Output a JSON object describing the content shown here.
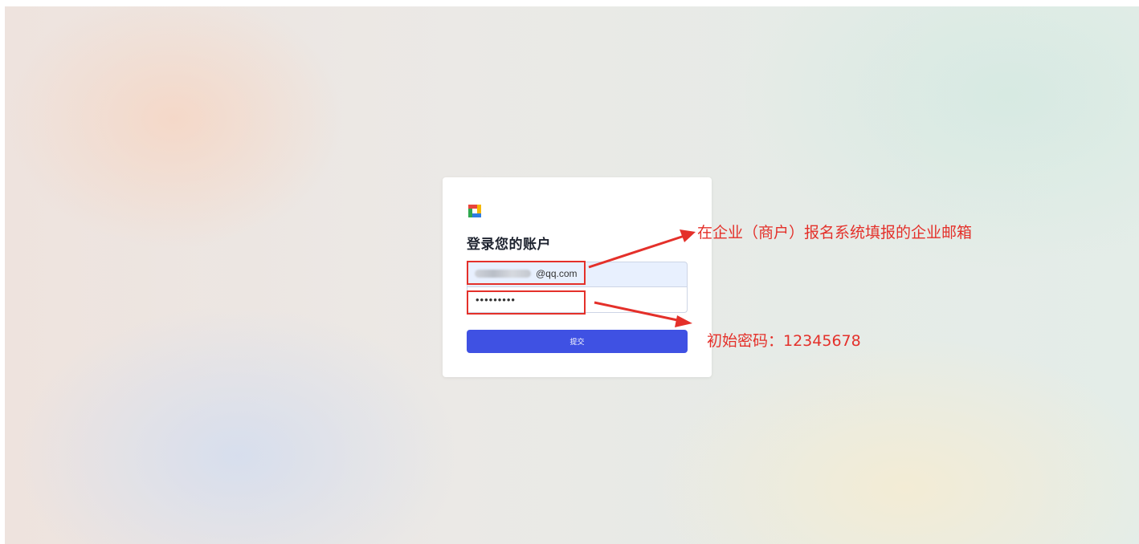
{
  "login": {
    "title": "登录您的账户",
    "email_value": "@qq.com",
    "password_value": "•••••••••",
    "submit_label": "提交"
  },
  "logo_colors": {
    "red": "#e8453c",
    "yellow": "#f5b800",
    "green": "#2fa84f",
    "blue": "#2f7de1"
  },
  "annotations": {
    "email_note": "在企业（商户）报名系统填报的企业邮箱",
    "password_note": "初始密码：12345678",
    "color": "#e4302a"
  },
  "colors": {
    "submit_button": "#3f51e3",
    "email_autofill": "#e8f0fe"
  }
}
